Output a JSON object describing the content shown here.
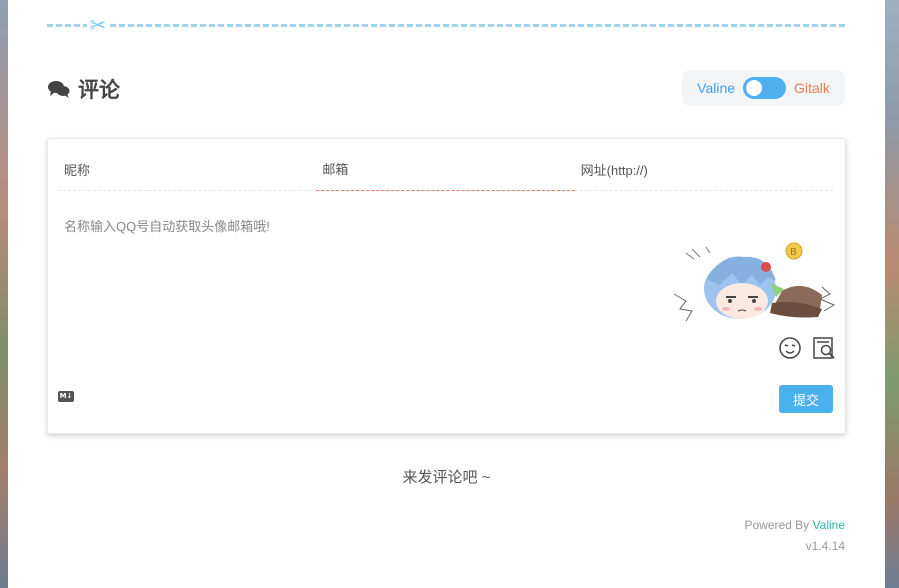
{
  "comments": {
    "title": "评论",
    "switcher": {
      "left_label": "Valine",
      "right_label": "Gitalk"
    }
  },
  "form": {
    "nick_placeholder": "昵称",
    "mail_placeholder": "邮箱",
    "link_placeholder": "网址(http://)",
    "textarea_placeholder": "名称输入QQ号自动获取头像邮箱哦!",
    "submit_label": "提交"
  },
  "empty_text": "来发评论吧 ~",
  "footer": {
    "powered_by": "Powered By",
    "brand": "Valine",
    "version": "v1.4.14"
  },
  "icons": {
    "scissors": "scissors-icon",
    "title": "comments-icon",
    "emoji": "emoji-icon",
    "preview": "preview-icon",
    "markdown": "markdown-icon"
  },
  "colors": {
    "accent": "#4ab1ee",
    "gitalk": "#f07c4c",
    "brand": "#2cb6a6"
  }
}
